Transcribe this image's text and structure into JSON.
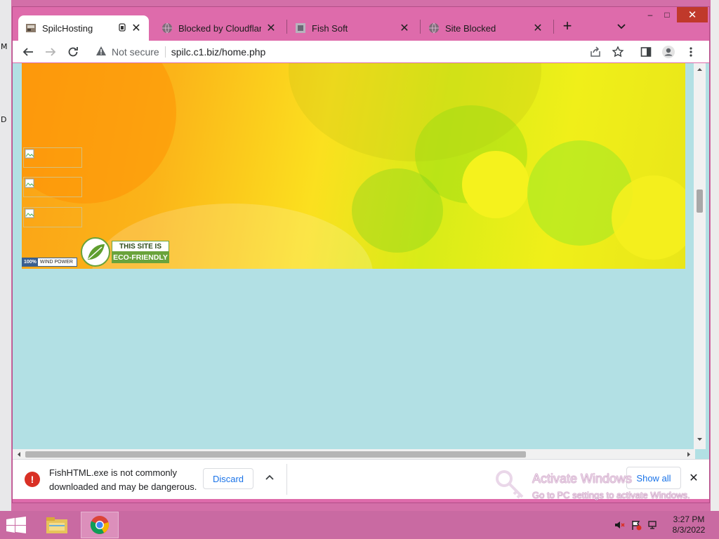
{
  "desktop": {
    "left_chars": [
      "M",
      "D"
    ]
  },
  "window_controls": {
    "minimize": "–",
    "maximize": "□",
    "close": "✕"
  },
  "tabs": [
    {
      "label": "SpilcHosting",
      "close": "✕",
      "active": true
    },
    {
      "label": "Blocked by Cloudflare C",
      "close": "✕",
      "active": false
    },
    {
      "label": "Fish Soft",
      "close": "✕",
      "active": false
    },
    {
      "label": "Site Blocked",
      "close": "✕",
      "active": false
    }
  ],
  "new_tab": "+",
  "omnibox": {
    "security_label": "Not secure",
    "url": "spilc.c1.biz/home.php"
  },
  "page": {
    "wind_badge": {
      "percent": "100%",
      "text": "WIND POWER"
    },
    "eco_badge": {
      "line1": "THIS SITE IS",
      "line2": "ECO-FRIENDLY"
    }
  },
  "download": {
    "message": "FishHTML.exe is not commonly downloaded and may be dangerous.",
    "discard_label": "Discard",
    "show_all_label": "Show all",
    "close": "✕",
    "error_glyph": "!"
  },
  "watermark": {
    "line1": "Activate Windows",
    "line2": "Go to PC settings to activate Windows."
  },
  "taskbar": {
    "time": "3:27 PM",
    "date": "8/3/2022"
  },
  "colors": {
    "titlebar": "#de6bab",
    "page_background": "#b2e0e4",
    "taskbar": "#c96aa2",
    "accent_link": "#1a73e8",
    "danger": "#d93025"
  }
}
